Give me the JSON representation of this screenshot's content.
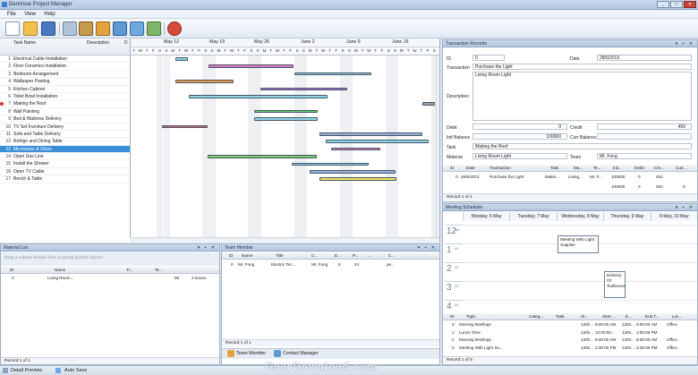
{
  "window": {
    "title": "Dennisse Project Manager",
    "min": "_",
    "max": "□",
    "close": "✕"
  },
  "menu": [
    "File",
    "View",
    "Help"
  ],
  "toolbar": {
    "icons": [
      "new-file-icon",
      "open-folder-icon",
      "save-icon",
      "print-icon",
      "notebook-icon",
      "people-icon",
      "team-icon",
      "users-icon",
      "tools-icon",
      "globe-icon",
      "power-icon"
    ]
  },
  "gantt": {
    "col_task": "Task Name",
    "col_desc": "Description",
    "col_d": "D",
    "weeks": [
      "May 12",
      "May 19",
      "May 26",
      "June 2",
      "June 9",
      "June 16"
    ],
    "day_letters": [
      "T",
      "W",
      "T",
      "F",
      "S",
      "S",
      "M",
      "T",
      "W",
      "T",
      "F",
      "S",
      "S",
      "M",
      "T",
      "W",
      "T",
      "F",
      "S",
      "S",
      "M",
      "T",
      "W",
      "T",
      "F",
      "S",
      "S",
      "M",
      "T",
      "W",
      "T",
      "F",
      "S",
      "S",
      "M",
      "T",
      "W",
      "T",
      "F",
      "S",
      "S",
      "M",
      "T",
      "W",
      "T",
      "F",
      "S"
    ],
    "tasks": [
      {
        "n": "1",
        "name": "Electrical Cable Installation"
      },
      {
        "n": "2",
        "name": "Floor Ceramics Installation"
      },
      {
        "n": "3",
        "name": "Bedroom Arrangement"
      },
      {
        "n": "4",
        "name": "Wallpaper Pasting"
      },
      {
        "n": "5",
        "name": "Kitchen Cabinet"
      },
      {
        "n": "6",
        "name": "Toilet Bowl Installation"
      },
      {
        "n": "7",
        "name": "Making the Roof"
      },
      {
        "n": "8",
        "name": "Wall Painting"
      },
      {
        "n": "9",
        "name": "Bed & Mattress Delivery"
      },
      {
        "n": "10",
        "name": "TV Set Furniture Delivery"
      },
      {
        "n": "11",
        "name": "Sofa and Table Delivery"
      },
      {
        "n": "12",
        "name": "Refrige and Dining Table"
      },
      {
        "n": "13",
        "name": "Microwave & Stove"
      },
      {
        "n": "14",
        "name": "Open Gas Line"
      },
      {
        "n": "15",
        "name": "Install the Shower"
      },
      {
        "n": "16",
        "name": "Open TV Cable"
      },
      {
        "n": "17",
        "name": "Bench & Table"
      }
    ]
  },
  "material": {
    "title": "Material List",
    "hint": "Drag a column header here to group by that column",
    "cols": [
      "ID",
      "Name",
      "Tr...",
      "Te..."
    ],
    "row": {
      "id": "0",
      "name": "Living Room...",
      "v1": "58",
      "v2": "2 boxes"
    },
    "nav": "Record 1 of 1"
  },
  "team": {
    "title": "Team Member",
    "cols": [
      "ID",
      "Name",
      "Title",
      "C...",
      "E...",
      "P...",
      "...",
      "C..."
    ],
    "row": {
      "id": "0",
      "name": "Mr. Fong",
      "title": "Electric Tec...",
      "c": "Mr. Fong",
      "e": "8",
      "p": "24",
      "x": "pe..."
    },
    "nav": "Record 1 of 1",
    "tab1": "Team Member",
    "tab2": "Contact Manager"
  },
  "trans": {
    "title": "Transaction Records",
    "labels": {
      "id": "ID",
      "date": "Date",
      "transaction": "Transaction",
      "description": "Description",
      "debit": "Debit",
      "credit": "Credit",
      "init_balance": "Init Balance",
      "curr_balance": "Curr Balance",
      "task": "Task",
      "material": "Material",
      "team": "Team"
    },
    "values": {
      "id": "0",
      "date": "28/6/2013",
      "transaction": "Purchase the Light",
      "description": "Living Room Light",
      "debit": "0",
      "credit": "450",
      "init_balance": "100000",
      "curr_balance": "",
      "task": "Making the Roof",
      "material": "Living Room Light",
      "team": "Mr. Fong"
    },
    "cols": [
      "ID",
      "Date",
      "Transaction",
      "Task",
      "Ma...",
      "Te...",
      "Init...",
      "Debit",
      "Cre...",
      "Curr..."
    ],
    "row": [
      "0",
      "28/6/2013",
      "Purchase the Light",
      "Makin...",
      "Living...",
      "Mr. F...",
      "100000",
      "0",
      "450"
    ],
    "totals": [
      "100000",
      "0",
      "450",
      "0"
    ],
    "nav": "Record 1 of 1"
  },
  "sched": {
    "title": "Meeting Scheduler",
    "days": [
      "Monday, 6 May",
      "Tuesday, 7 May",
      "Wednesday, 8 May",
      "Thursday, 9 May",
      "Friday, 10 May"
    ],
    "hours": [
      {
        "h": "12",
        "s": "am"
      },
      {
        "h": "1",
        "s": "00"
      },
      {
        "h": "2",
        "s": "00"
      },
      {
        "h": "3",
        "s": "00"
      },
      {
        "h": "4",
        "s": "00"
      }
    ],
    "appts": [
      {
        "text": "Meeting With Light Supplier"
      },
      {
        "text": "Delivery Of Toolboxes"
      }
    ],
    "cols": [
      "ID",
      "Topic",
      "Categ...",
      "Task",
      "St...",
      "Start ...",
      "E...",
      "End T...",
      "Loc..."
    ],
    "rows": [
      {
        "id": "0",
        "topic": "Morning Briefings",
        "st": "13/5/...",
        "start": "8:00:00 AM",
        "e": "13/5/...",
        "end": "9:00:00 AM",
        "loc": "Office"
      },
      {
        "id": "1",
        "topic": "Lunch Time",
        "st": "13/5/...",
        "start": "12:00:00...",
        "e": "13/5/...",
        "end": "1:00:00 PM",
        "loc": ""
      },
      {
        "id": "2",
        "topic": "Morning Briefings",
        "st": "13/5/...",
        "start": "8:00:00 AM",
        "e": "13/5/...",
        "end": "9:00:00 AM",
        "loc": "Office"
      },
      {
        "id": "3",
        "topic": "Meeting With Light Su...",
        "st": "13/5/...",
        "start": "2:30:00 PM",
        "e": "13/5/...",
        "end": "3:30:00 PM",
        "loc": "Office"
      }
    ],
    "nav": "Record 1 of 5"
  },
  "status": {
    "detail": "Detail Preview",
    "autosave": "Auto Save",
    "watermark": "GearDownload.com"
  }
}
